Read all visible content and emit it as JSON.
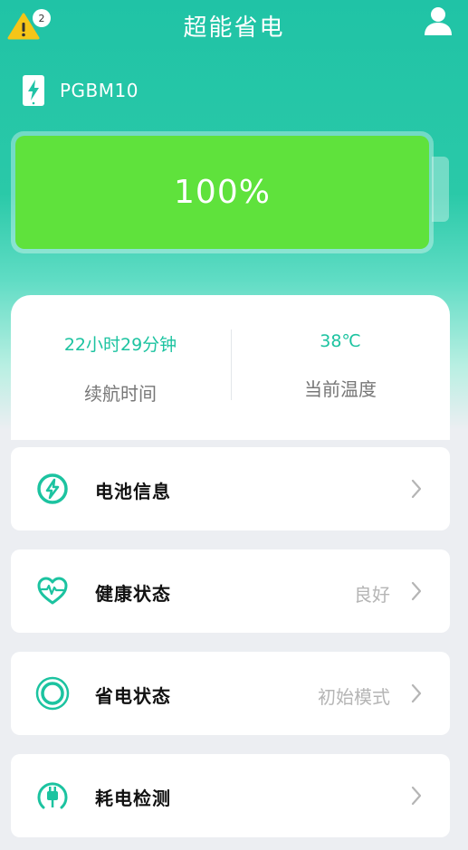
{
  "header": {
    "title": "超能省电",
    "alert_count": "2"
  },
  "device": {
    "name": "PGBM10"
  },
  "battery": {
    "percent_label": "100%",
    "level": 1.0
  },
  "stats": {
    "endurance_value": "22小时29分钟",
    "endurance_label": "续航时间",
    "temperature_value": "38℃",
    "temperature_label": "当前温度"
  },
  "menu": [
    {
      "label": "电池信息",
      "value": "",
      "icon": "battery-bolt-icon"
    },
    {
      "label": "健康状态",
      "value": "良好",
      "icon": "heart-pulse-icon"
    },
    {
      "label": "省电状态",
      "value": "初始模式",
      "icon": "ring-icon"
    },
    {
      "label": "耗电检测",
      "value": "",
      "icon": "plug-icon"
    }
  ],
  "colors": {
    "accent": "#1cc3a0",
    "battery_fill": "#5fe23c",
    "warning": "#f5c518"
  }
}
